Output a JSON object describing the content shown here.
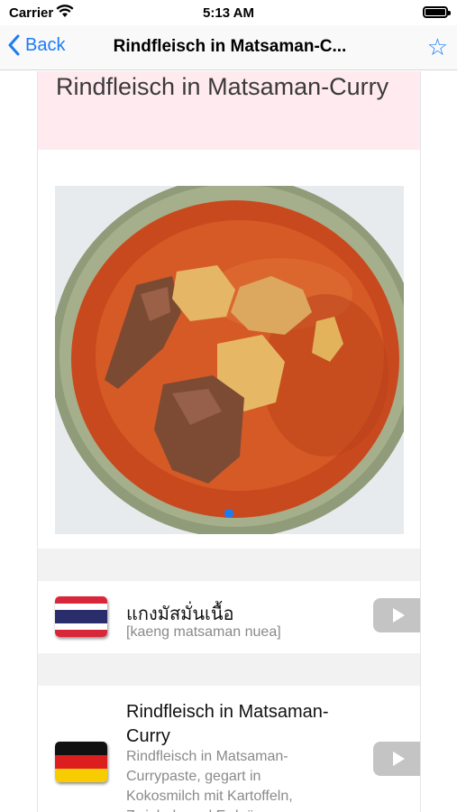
{
  "status_bar": {
    "carrier": "Carrier",
    "time": "5:13 AM"
  },
  "nav": {
    "back_label": "Back",
    "title": "Rindfleisch in Matsaman-C..."
  },
  "dish": {
    "title": "Rindfleisch in Matsaman-Curry",
    "photo_pages": 1,
    "current_page": 1
  },
  "translations": [
    {
      "language": "Thai",
      "flag": "thailand-flag",
      "primary": "แกงมัสมั่นเนื้อ",
      "secondary": "[kaeng matsaman nuea]"
    },
    {
      "language": "German",
      "flag": "germany-flag",
      "primary": "Rindfleisch in Matsaman-Curry",
      "secondary": "Rindfleisch in Matsaman-Currypaste, gegart in Kokosmilch mit Kartoffeln, Zwiebeln und Erdnüssen"
    }
  ],
  "colors": {
    "accent": "#1a7cf5",
    "title_band": "#ffeaf0"
  }
}
